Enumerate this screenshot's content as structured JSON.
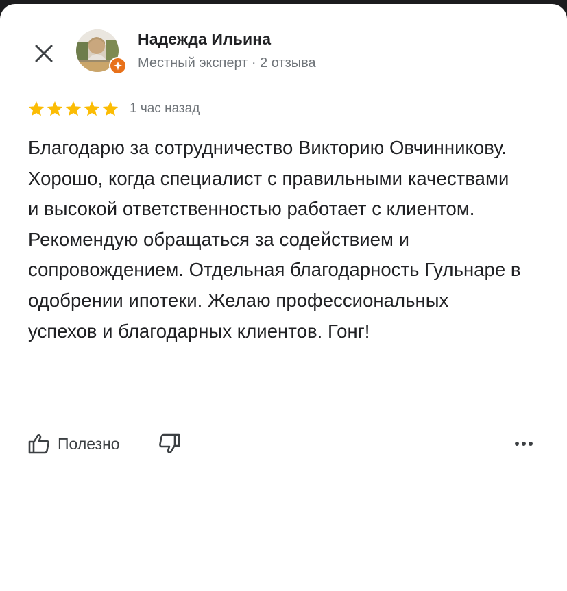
{
  "review": {
    "author": {
      "name": "Надежда Ильина",
      "meta": "Местный эксперт · 2 отзыва",
      "badge_color": "#e8711a"
    },
    "rating": 5,
    "rating_max": 5,
    "star_color": "#fbbc04",
    "time": "1 час назад",
    "text": "Благодарю за сотрудничество Викторию Овчинникову. Хорошо, когда специалист с правильными качествами и высокой ответственностью работает с клиентом. Рекомендую обращаться за содействием и сопровождением. Отдельная благодарность Гульнаре в одобрении ипотеки. Желаю профессиональных успехов и благодарных клиентов. Гонг!"
  },
  "actions": {
    "helpful_label": "Полезно",
    "helpful_icon": "thumb-up-icon",
    "dislike_icon": "thumb-down-icon",
    "more_icon": "more-horizontal-icon",
    "close_icon": "close-icon"
  }
}
